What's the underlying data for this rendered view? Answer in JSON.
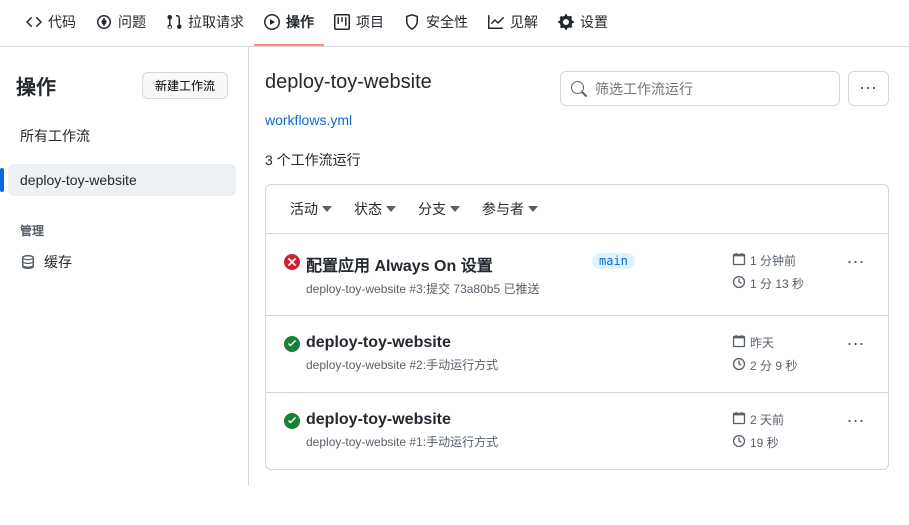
{
  "topnav": {
    "code": "代码",
    "issues": "问题",
    "pulls": "拉取请求",
    "actions": "操作",
    "projects": "项目",
    "security": "安全性",
    "insights": "见解",
    "settings": "设置"
  },
  "sidebar": {
    "title": "操作",
    "new_workflow": "新建工作流",
    "all_workflows": "所有工作流",
    "deploy": "deploy-toy-website",
    "management": "管理",
    "cache": "缓存"
  },
  "workflow": {
    "title": "deploy-toy-website",
    "yml": "workflows.yml",
    "search_placeholder": "筛选工作流运行",
    "run_count": "3 个工作流运行"
  },
  "filters": {
    "activity": "活动",
    "status": "状态",
    "branch": "分支",
    "actor": "参与者"
  },
  "runs": [
    {
      "status": "fail",
      "title": "配置应用 Always On 设置",
      "sub": "deploy-toy-website #3:提交 73a80b5 已推送",
      "branch": "main",
      "time": "1 分钟前",
      "duration": "1 分 13 秒"
    },
    {
      "status": "ok",
      "title": "deploy-toy-website",
      "sub": "deploy-toy-website #2:手动运行方式",
      "branch": "",
      "time": "昨天",
      "duration": "2 分 9 秒"
    },
    {
      "status": "ok",
      "title": "deploy-toy-website",
      "sub": "deploy-toy-website #1:手动运行方式",
      "branch": "",
      "time": "2 天前",
      "duration": "19 秒"
    }
  ]
}
